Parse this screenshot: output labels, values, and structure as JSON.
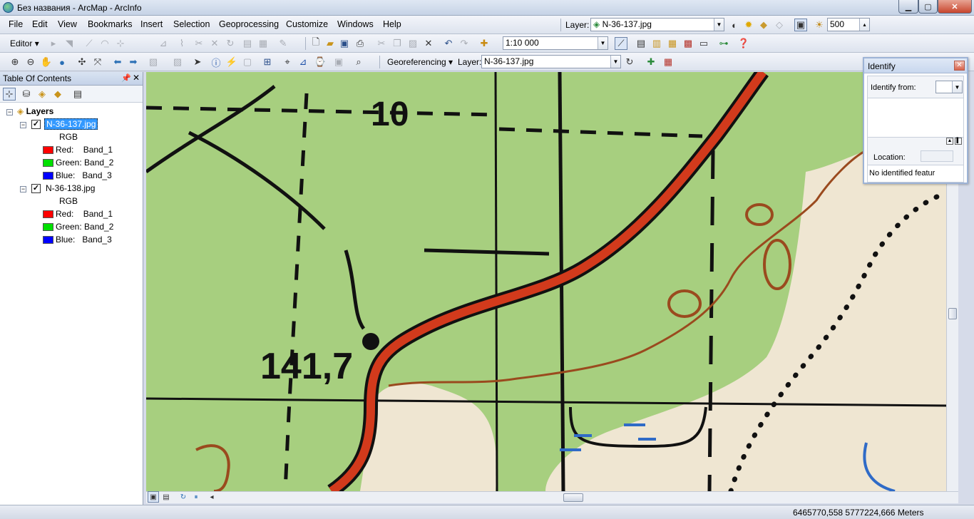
{
  "window": {
    "title": "Без названия - ArcMap - ArcInfo",
    "min_label": "▁",
    "max_label": "▢",
    "close_label": "✕"
  },
  "menu": [
    "File",
    "Edit",
    "View",
    "Bookmarks",
    "Insert",
    "Selection",
    "Geoprocessing",
    "Customize",
    "Windows",
    "Help"
  ],
  "toolbar": {
    "layer_label": "Layer:",
    "layer_value": "N-36-137.jpg",
    "zoom_value": "500",
    "editor_label": "Editor",
    "scale_value": "1:10 000",
    "georef_label": "Georeferencing",
    "georef_layer_label": "Layer:",
    "georef_layer_value": "N-36-137.jpg"
  },
  "toc": {
    "title": "Table Of Contents",
    "root": "Layers",
    "layers": [
      {
        "name": "N-36-137.jpg",
        "checked": true,
        "selected": true,
        "renderer": "RGB",
        "bands": [
          {
            "channel": "Red:",
            "band": "Band_1",
            "color": "#ff0000"
          },
          {
            "channel": "Green:",
            "band": "Band_2",
            "color": "#00e000"
          },
          {
            "channel": "Blue:",
            "band": "Band_3",
            "color": "#0000ff"
          }
        ]
      },
      {
        "name": "N-36-138.jpg",
        "checked": true,
        "selected": false,
        "renderer": "RGB",
        "bands": [
          {
            "channel": "Red:",
            "band": "Band_1",
            "color": "#ff0000"
          },
          {
            "channel": "Green:",
            "band": "Band_2",
            "color": "#00e000"
          },
          {
            "channel": "Blue:",
            "band": "Band_3",
            "color": "#0000ff"
          }
        ]
      }
    ]
  },
  "map": {
    "labels": [
      {
        "text": "10"
      },
      {
        "text": "141,7"
      }
    ],
    "colors": {
      "forest": "#a7cf7f",
      "open": "#efe6d2",
      "road": "#d23a1c",
      "contour": "#9a4a1e",
      "water": "#2f6bc7"
    }
  },
  "identify": {
    "title": "Identify",
    "identify_from_label": "Identify from:",
    "location_label": "Location:",
    "result_text": "No identified featur"
  },
  "status": {
    "coords": "6465770,558  5777224,666 Meters"
  }
}
